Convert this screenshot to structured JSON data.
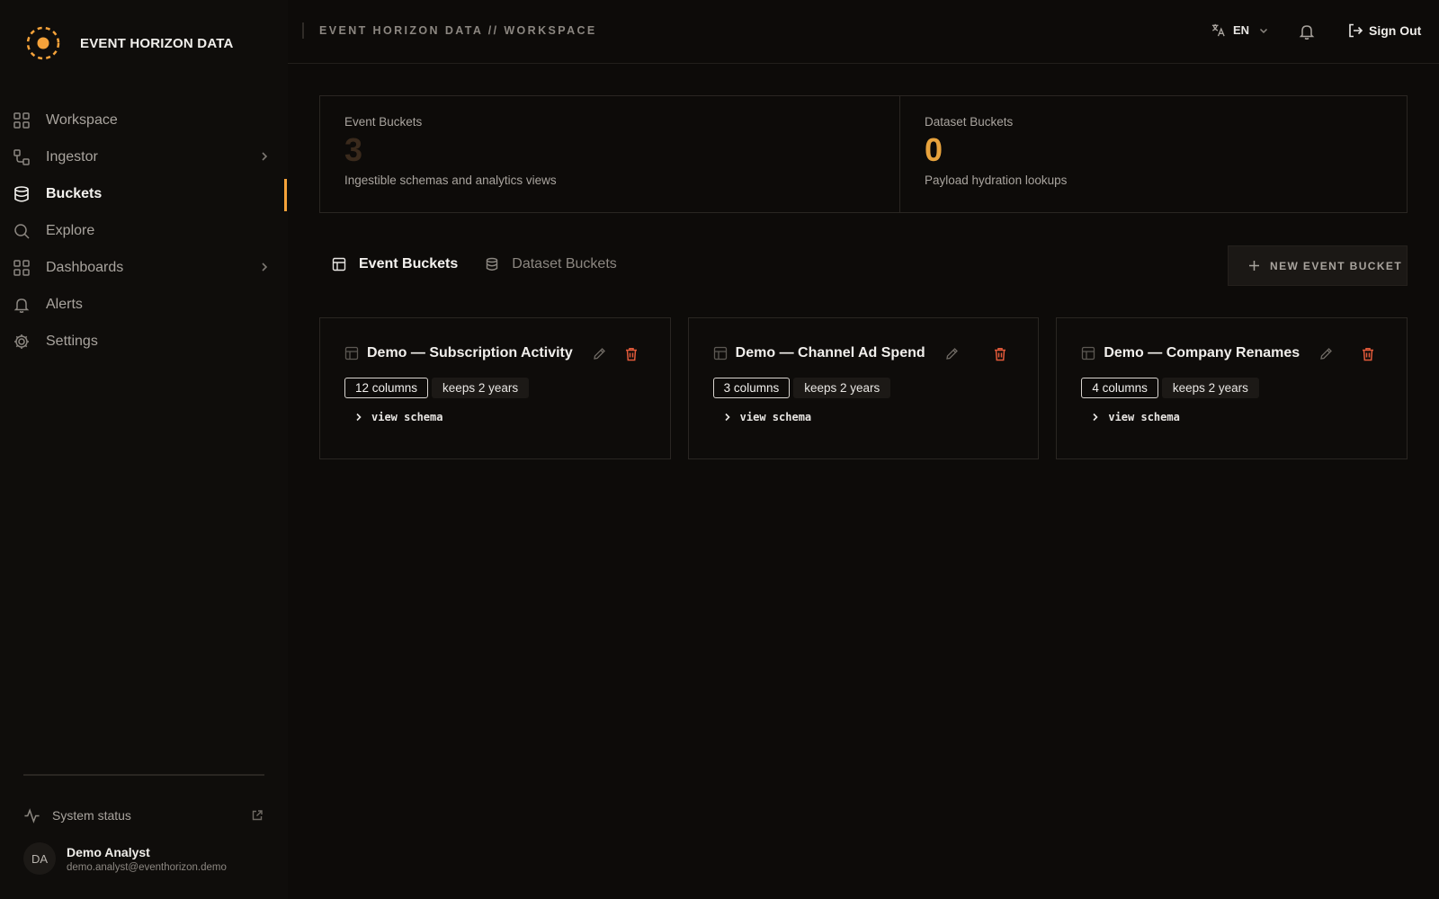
{
  "brand": {
    "name": "EVENT HORIZON DATA"
  },
  "colors": {
    "accent": "#f5a23a",
    "danger": "#e25a3a",
    "stat_zero": "#e8a33d",
    "stat_dim": "#3a2a1c"
  },
  "sidebar": {
    "items": [
      {
        "label": "Workspace",
        "icon": "grid-icon"
      },
      {
        "label": "Ingestor",
        "icon": "flow-icon",
        "has_submenu": true
      },
      {
        "label": "Buckets",
        "icon": "database-icon",
        "active": true
      },
      {
        "label": "Explore",
        "icon": "search-icon"
      },
      {
        "label": "Dashboards",
        "icon": "grid-icon",
        "has_submenu": true
      },
      {
        "label": "Alerts",
        "icon": "bell-icon"
      },
      {
        "label": "Settings",
        "icon": "gear-icon"
      }
    ],
    "system_status": "System status",
    "user": {
      "initials": "DA",
      "name": "Demo Analyst",
      "email": "demo.analyst@eventhorizon.demo"
    }
  },
  "topbar": {
    "breadcrumb": "EVENT HORIZON DATA // WORKSPACE",
    "language": "EN",
    "sign_out": "Sign Out"
  },
  "stats": [
    {
      "title": "Event Buckets",
      "value": "3",
      "description": "Ingestible schemas and analytics views"
    },
    {
      "title": "Dataset Buckets",
      "value": "0",
      "description": "Payload hydration lookups"
    }
  ],
  "tabs": [
    {
      "label": "Event Buckets",
      "icon": "table-icon",
      "active": true
    },
    {
      "label": "Dataset Buckets",
      "icon": "database-icon",
      "active": false
    }
  ],
  "new_bucket_label": "NEW EVENT BUCKET",
  "cards": [
    {
      "title": "Demo — Subscription Activity",
      "columns": "12 columns",
      "retention": "keeps 2 years",
      "view_schema": "view schema"
    },
    {
      "title": "Demo — Channel Ad Spend",
      "columns": "3 columns",
      "retention": "keeps 2 years",
      "view_schema": "view schema"
    },
    {
      "title": "Demo — Company Renames",
      "columns": "4 columns",
      "retention": "keeps 2 years",
      "view_schema": "view schema"
    }
  ]
}
